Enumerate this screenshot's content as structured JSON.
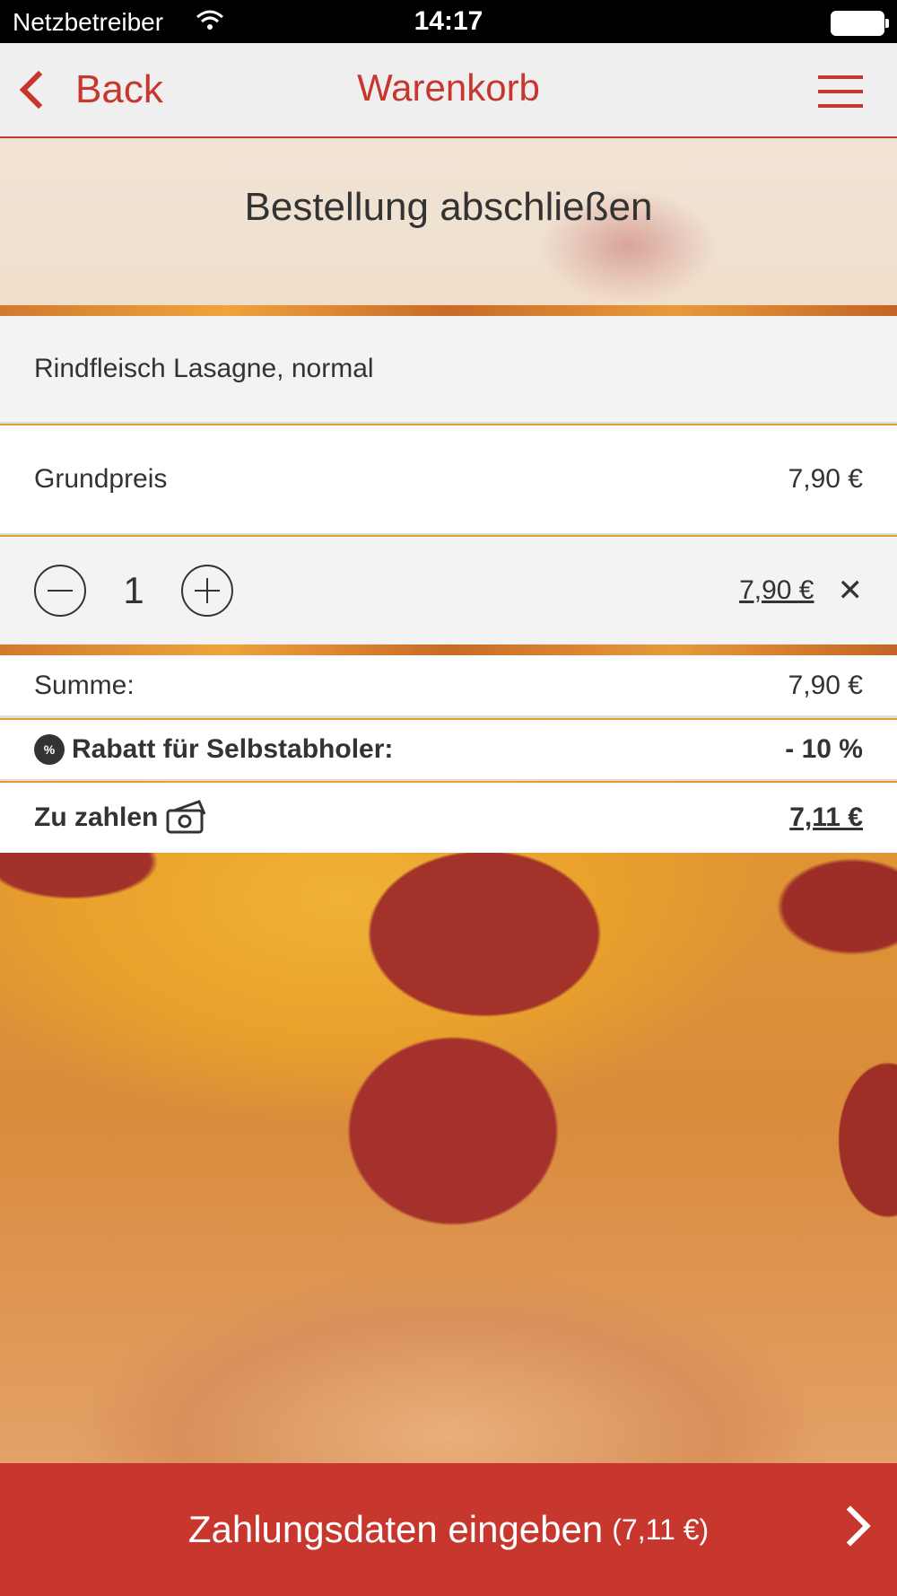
{
  "status_bar": {
    "carrier": "Netzbetreiber",
    "time": "14:17"
  },
  "nav": {
    "back_label": "Back",
    "title": "Warenkorb"
  },
  "hero": {
    "text": "Bestellung abschließen"
  },
  "item": {
    "name": "Rindfleisch Lasagne, normal",
    "base_label": "Grundpreis",
    "base_price": "7,90 €",
    "quantity": "1",
    "line_total": "7,90 €"
  },
  "summary": {
    "sum_label": "Summe:",
    "sum_value": "7,90 €",
    "discount_label": "Rabatt für Selbstabholer:",
    "discount_value": "- 10 %",
    "badge_symbol": "%",
    "pay_label": "Zu zahlen",
    "pay_value": "7,11 €"
  },
  "cta": {
    "label": "Zahlungsdaten eingeben",
    "amount": "(7,11 €)"
  },
  "colors": {
    "accent": "#c8372e"
  }
}
